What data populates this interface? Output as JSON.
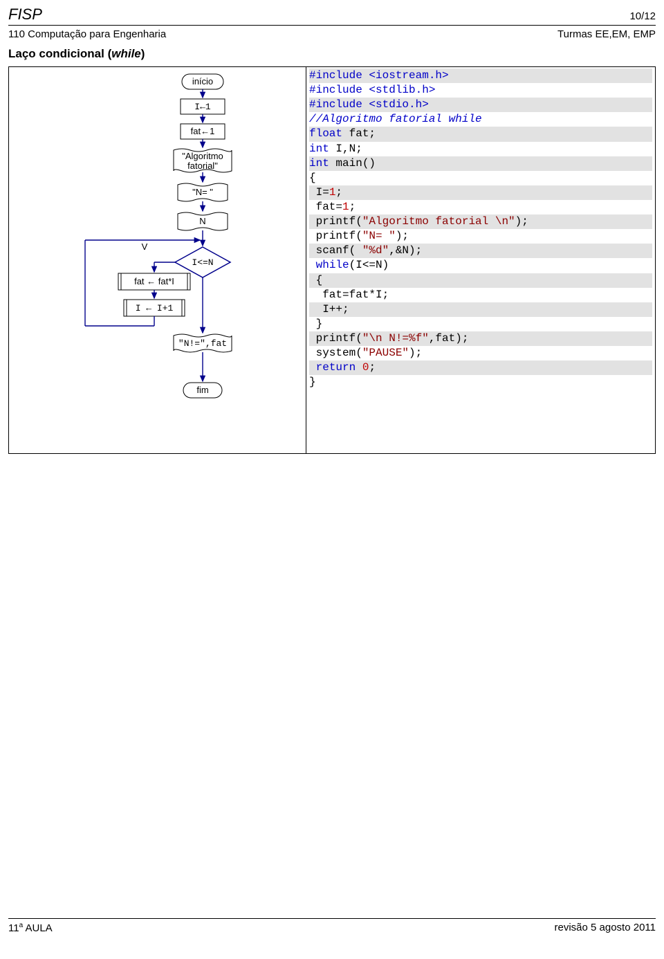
{
  "header": {
    "title": "FISP",
    "page": "10/12",
    "course": "110 Computação para Engenharia",
    "classes": "Turmas EE,EM, EMP"
  },
  "section": {
    "prefix": "Laço condicional (",
    "ital": "while",
    "suffix": ")"
  },
  "flow": {
    "inicio": "início",
    "i1": "I←1",
    "fat1": "fat←1",
    "algo1": "\"Algoritmo",
    "algo2": "fatorial\"",
    "neq": "\"N= \"",
    "n": "N",
    "v": "V",
    "cond": "I<=N",
    "fatfat": "fat ← fat*I",
    "ii1": "I ← I+1",
    "out": "\"N!=\",fat",
    "fim": "fim"
  },
  "code": [
    {
      "shade": true,
      "spans": [
        {
          "c": "cl-blue",
          "t": "#include <iostream.h>"
        }
      ]
    },
    {
      "shade": false,
      "spans": [
        {
          "c": "cl-blue",
          "t": "#include <stdlib.h>"
        }
      ]
    },
    {
      "shade": true,
      "spans": [
        {
          "c": "cl-blue",
          "t": "#include <stdio.h>"
        }
      ]
    },
    {
      "shade": false,
      "spans": [
        {
          "c": "cl-blue-ital",
          "t": "//Algoritmo fatorial while"
        }
      ]
    },
    {
      "shade": true,
      "spans": [
        {
          "c": "cl-blue",
          "t": "float"
        },
        {
          "c": "cl-black",
          "t": " fat;"
        }
      ]
    },
    {
      "shade": false,
      "spans": [
        {
          "c": "cl-blue",
          "t": "int"
        },
        {
          "c": "cl-black",
          "t": " I,N;"
        }
      ]
    },
    {
      "shade": true,
      "spans": [
        {
          "c": "cl-blue",
          "t": "int"
        },
        {
          "c": "cl-black",
          "t": " main()"
        }
      ]
    },
    {
      "shade": false,
      "spans": [
        {
          "c": "cl-black",
          "t": "{"
        }
      ]
    },
    {
      "shade": true,
      "spans": [
        {
          "c": "cl-black",
          "t": " I="
        },
        {
          "c": "cl-red",
          "t": "1"
        },
        {
          "c": "cl-black",
          "t": ";"
        }
      ]
    },
    {
      "shade": false,
      "spans": [
        {
          "c": "cl-black",
          "t": " fat="
        },
        {
          "c": "cl-red",
          "t": "1"
        },
        {
          "c": "cl-black",
          "t": ";"
        }
      ]
    },
    {
      "shade": true,
      "spans": [
        {
          "c": "cl-black",
          "t": " printf("
        },
        {
          "c": "cl-brown",
          "t": "\"Algoritmo fatorial \\n\""
        },
        {
          "c": "cl-black",
          "t": ");"
        }
      ]
    },
    {
      "shade": false,
      "spans": [
        {
          "c": "cl-black",
          "t": " printf("
        },
        {
          "c": "cl-brown",
          "t": "\"N= \""
        },
        {
          "c": "cl-black",
          "t": ");"
        }
      ]
    },
    {
      "shade": true,
      "spans": [
        {
          "c": "cl-black",
          "t": " scanf( "
        },
        {
          "c": "cl-brown",
          "t": "\"%d\""
        },
        {
          "c": "cl-black",
          "t": ",&N);"
        }
      ]
    },
    {
      "shade": false,
      "spans": [
        {
          "c": "cl-black",
          "t": " "
        },
        {
          "c": "cl-blue",
          "t": "while"
        },
        {
          "c": "cl-black",
          "t": "(I<=N)"
        }
      ]
    },
    {
      "shade": true,
      "spans": [
        {
          "c": "cl-black",
          "t": " {"
        }
      ]
    },
    {
      "shade": false,
      "spans": [
        {
          "c": "cl-black",
          "t": "  fat=fat*I;"
        }
      ]
    },
    {
      "shade": true,
      "spans": [
        {
          "c": "cl-black",
          "t": "  I++;"
        }
      ]
    },
    {
      "shade": false,
      "spans": [
        {
          "c": "cl-black",
          "t": " }"
        }
      ]
    },
    {
      "shade": true,
      "spans": [
        {
          "c": "cl-black",
          "t": " printf("
        },
        {
          "c": "cl-brown",
          "t": "\"\\n N!=%f\""
        },
        {
          "c": "cl-black",
          "t": ",fat);"
        }
      ]
    },
    {
      "shade": false,
      "spans": [
        {
          "c": "cl-black",
          "t": " system("
        },
        {
          "c": "cl-brown",
          "t": "\"PAUSE\""
        },
        {
          "c": "cl-black",
          "t": ");"
        }
      ]
    },
    {
      "shade": true,
      "spans": [
        {
          "c": "cl-black",
          "t": " "
        },
        {
          "c": "cl-blue",
          "t": "return"
        },
        {
          "c": "cl-black",
          "t": " "
        },
        {
          "c": "cl-red",
          "t": "0"
        },
        {
          "c": "cl-black",
          "t": ";"
        }
      ]
    },
    {
      "shade": false,
      "spans": [
        {
          "c": "cl-black",
          "t": "}"
        }
      ]
    }
  ],
  "footer": {
    "left_num": "11",
    "left_sup": "a",
    "left_rest": " AULA",
    "right": "revisão 5 agosto 2011"
  }
}
